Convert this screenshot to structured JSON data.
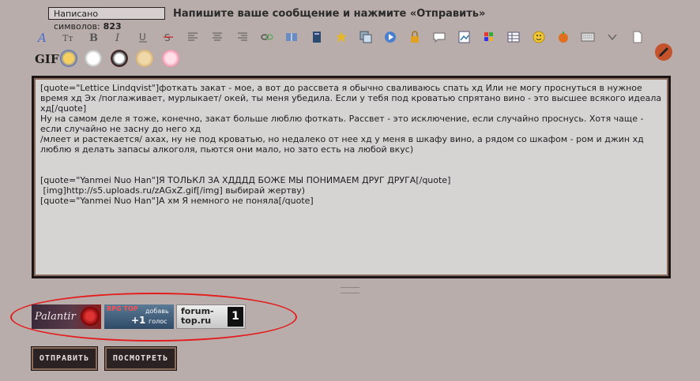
{
  "counter": {
    "label": "Написано символов:",
    "value": "823"
  },
  "header": {
    "title": "Напишите ваше сообщение и нажмите «Отправить»"
  },
  "toolbar": {
    "items": [
      "font",
      "size",
      "bold",
      "italic",
      "underline",
      "strike",
      "align-left",
      "align-center",
      "align-right",
      "link",
      "book",
      "book2",
      "star",
      "copy",
      "media",
      "lock",
      "speech",
      "image",
      "palette",
      "table",
      "smile",
      "pumpkin",
      "keyboard",
      "expand",
      "spoiler"
    ]
  },
  "smilies": {
    "gif_label": "GIF"
  },
  "editor": {
    "lines": [
      "[quote=\"Lettice Lindqvist\"]фоткать закат - мое, а вот до рассвета я обычно сваливаюсь спать хд Или не могу проснуться в нужное время хд Эх /поглаживает, мурлыкает/ окей, ты меня убедила. Если у тебя под кроватью спрятано вино - это высшее всякого идеала хд[/quote]",
      "Ну на самом деле я тоже, конечно, закат больше люблю фоткать. Рассвет - это исключение, если случайно проснусь. Хотя чаще - если случайно не засну до него хд",
      "/млеет и растекается/ ахах, ну не под кроватью, но недалеко от нее хд у меня в шкафу вино, а рядом со шкафом - ром и джин хд люблю я делать запасы алкоголя, пьются они мало, но зато есть на любой вкус)",
      "",
      "",
      "[quote=\"Yanmei Nuo Han\"]Я ТОЛЬКЛ ЗА ХДДДД БОЖЕ МЫ ПОНИМАЕМ ДРУГ ДРУГА[/quote]",
      " [img]http://s5.uploads.ru/zAGxZ.gif[/img] выбирай жертву)",
      "[quote=\"Yanmei Nuo Han\"]А хм Я немного не поняла[/quote]"
    ]
  },
  "banners": {
    "palantir": "Palantir",
    "rpg_top": "RPG TOP",
    "vote_add": "добавь",
    "vote_plus": "+1",
    "vote_word": "голос",
    "forum_top": "forum-\ntop.ru",
    "forum_num": "1"
  },
  "buttons": {
    "submit": "ОТПРАВИТЬ",
    "preview": "ПОСМОТРЕТЬ"
  },
  "colors": {
    "background": "#b9adac",
    "annotation": "#e31d1d",
    "button_bg": "#2b2323"
  }
}
